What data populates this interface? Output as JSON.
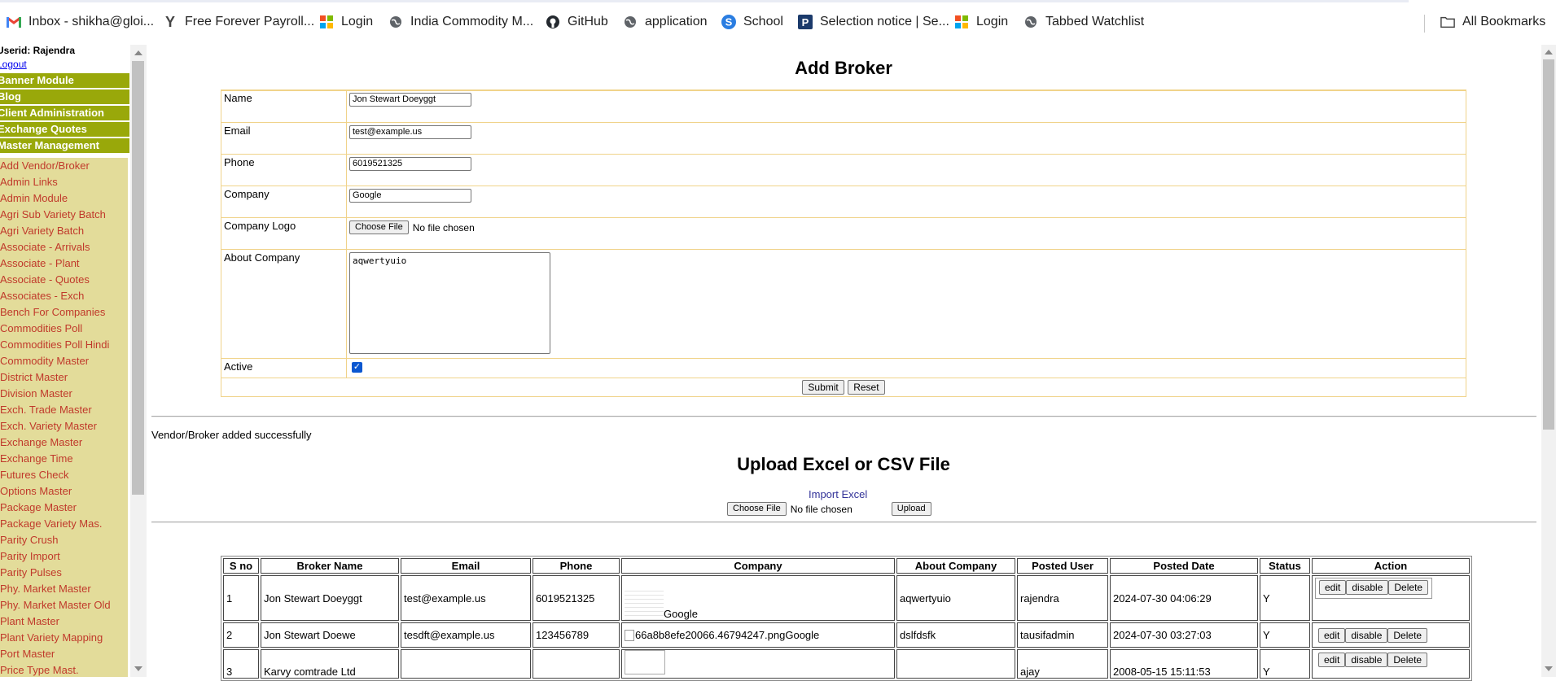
{
  "bookmarks": [
    {
      "label": "Inbox - shikha@gloi...",
      "icon": "gmail-icon"
    },
    {
      "label": "Free Forever Payroll...",
      "icon": "y-logo-icon"
    },
    {
      "label": "Login",
      "icon": "windows-grid-icon"
    },
    {
      "label": "India Commodity M...",
      "icon": "globe-icon"
    },
    {
      "label": "GitHub",
      "icon": "github-icon"
    },
    {
      "label": "application",
      "icon": "globe-icon"
    },
    {
      "label": "School",
      "icon": "s-circle-icon"
    },
    {
      "label": "Selection notice | Se...",
      "icon": "p-square-icon"
    },
    {
      "label": "Login",
      "icon": "windows-grid-icon"
    },
    {
      "label": "Tabbed Watchlist",
      "icon": "globe-icon"
    },
    {
      "label": "All Bookmarks",
      "icon": "folder-icon"
    }
  ],
  "sidebar": {
    "userid": "Userid: Rajendra",
    "logout": "Logout",
    "modules": [
      "Banner Module",
      "Blog",
      "Client Administration",
      "Exchange Quotes",
      "Master Management"
    ],
    "items": [
      "Add Vendor/Broker",
      "Admin Links",
      "Admin Module",
      "Agri Sub Variety Batch",
      "Agri Variety Batch",
      "Associate - Arrivals",
      "Associate - Plant",
      "Associate - Quotes",
      "Associates - Exch",
      "Bench For Companies",
      "Commodities Poll",
      "Commodities Poll Hindi",
      "Commodity Master",
      "District Master",
      "Division Master",
      "Exch. Trade Master",
      "Exch. Variety Master",
      "Exchange Master",
      "Exchange Time",
      "Futures Check",
      "Options Master",
      "Package Master",
      "Package Variety Mas.",
      "Parity Crush",
      "Parity Import",
      "Parity Pulses",
      "Phy. Market Master",
      "Phy. Market Master Old",
      "Plant Master",
      "Plant Variety Mapping",
      "Port Master",
      "Price Type Mast."
    ]
  },
  "form": {
    "title": "Add Broker",
    "name_label": "Name",
    "name_value": "Jon Stewart Doeyggt",
    "email_label": "Email",
    "email_value": "test@example.us",
    "phone_label": "Phone",
    "phone_value": "6019521325",
    "company_label": "Company",
    "company_value": "Google",
    "logo_label": "Company Logo",
    "choose_file": "Choose File",
    "no_file": "No file chosen",
    "about_label": "About Company",
    "about_value": "aqwertyuio",
    "active_label": "Active",
    "submit": "Submit",
    "reset": "Reset"
  },
  "message": "Vendor/Broker added successfully",
  "upload": {
    "title": "Upload Excel or CSV File",
    "import_label": "Import Excel",
    "choose_file": "Choose File",
    "no_file": "No file chosen",
    "upload_button": "Upload"
  },
  "table": {
    "headers": [
      "S no",
      "Broker Name",
      "Email",
      "Phone",
      "Company",
      "About Company",
      "Posted User",
      "Posted Date",
      "Status",
      "Action"
    ],
    "rows": [
      {
        "sno": "1",
        "name": "Jon Stewart Doeyggt",
        "email": "test@example.us",
        "phone": "6019521325",
        "company": "Google",
        "about": "aqwertyuio",
        "user": "rajendra",
        "date": "2024-07-30 04:06:29",
        "status": "Y"
      },
      {
        "sno": "2",
        "name": "Jon Stewart Doewe",
        "email": "tesdft@example.us",
        "phone": "123456789",
        "company": "66a8b8efe20066.46794247.pngGoogle",
        "about": "dslfdsfk",
        "user": "tausifadmin",
        "date": "2024-07-30 03:27:03",
        "status": "Y"
      },
      {
        "sno": "3",
        "name": "Karvy comtrade Ltd",
        "email": "",
        "phone": "",
        "company": "",
        "about": "",
        "user": "ajay",
        "date": "2008-05-15 15:11:53",
        "status": "Y"
      }
    ],
    "actions": {
      "edit": "edit",
      "disable": "disable",
      "delete": "Delete"
    }
  }
}
